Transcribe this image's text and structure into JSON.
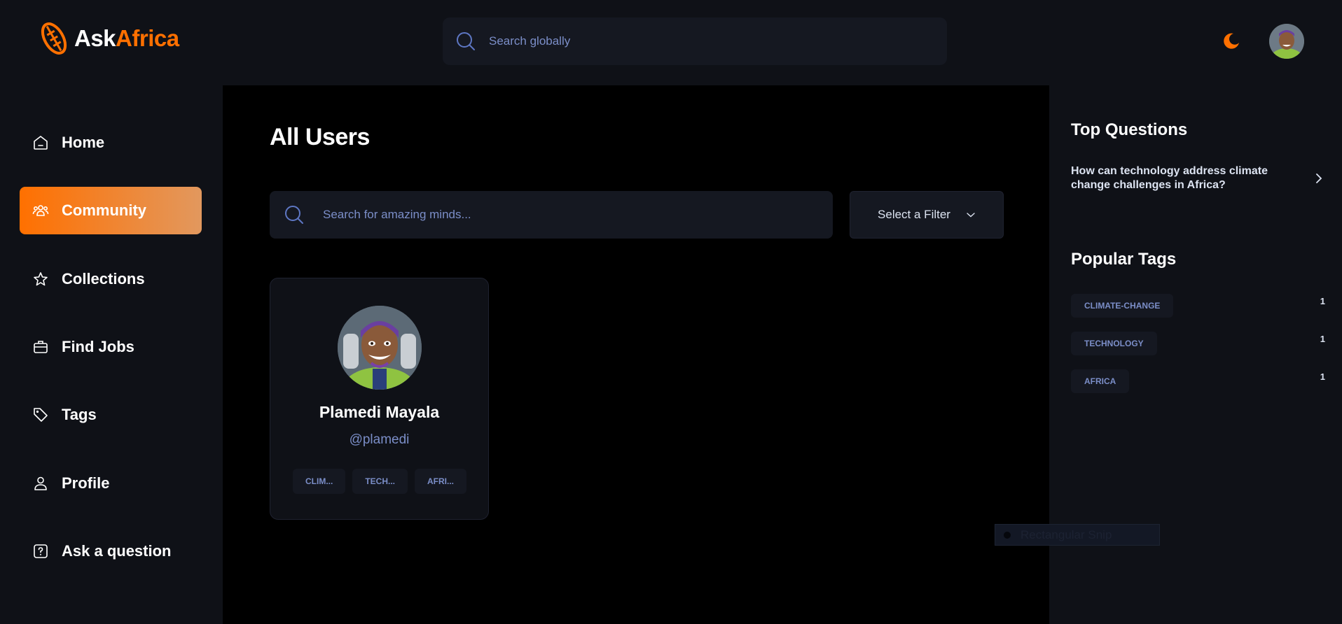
{
  "app": {
    "logo_part1": "Ask",
    "logo_part2": "Africa",
    "brand_color": "#ff7000"
  },
  "header": {
    "search_placeholder": "Search globally",
    "search_icon": "search-icon",
    "theme_icon": "moon-icon"
  },
  "sidebar": {
    "items": [
      {
        "label": "Home",
        "icon": "home-icon",
        "active": false
      },
      {
        "label": "Community",
        "icon": "users-icon",
        "active": true
      },
      {
        "label": "Collections",
        "icon": "star-icon",
        "active": false
      },
      {
        "label": "Find Jobs",
        "icon": "briefcase-icon",
        "active": false
      },
      {
        "label": "Tags",
        "icon": "tag-icon",
        "active": false
      },
      {
        "label": "Profile",
        "icon": "user-icon",
        "active": false
      },
      {
        "label": "Ask a question",
        "icon": "question-icon",
        "active": false
      }
    ]
  },
  "main": {
    "title": "All Users",
    "search_placeholder": "Search for amazing minds...",
    "filter_label": "Select a Filter",
    "users": [
      {
        "name": "Plamedi Mayala",
        "handle": "@plamedi",
        "tags": [
          "CLIM...",
          "TECH...",
          "AFRI..."
        ]
      }
    ]
  },
  "right_sidebar": {
    "top_questions_title": "Top Questions",
    "questions": [
      "How can technology address climate change challenges in Africa?"
    ],
    "popular_tags_title": "Popular Tags",
    "tags": [
      {
        "name": "CLIMATE-CHANGE",
        "count": "1"
      },
      {
        "name": "TECHNOLOGY",
        "count": "1"
      },
      {
        "name": "AFRICA",
        "count": "1"
      }
    ]
  },
  "overlay": {
    "snip_label": "Rectangular Snip"
  }
}
